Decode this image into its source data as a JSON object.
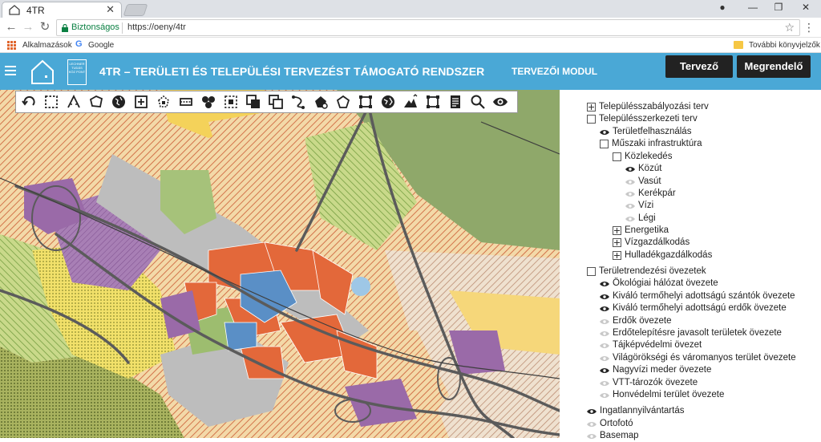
{
  "browser": {
    "tab_title": "4TR",
    "secure_label": "Biztonságos",
    "url": "https://oeny/4tr",
    "bookmarks": {
      "apps": "Alkalmazások",
      "google": "Google",
      "more": "További könyvjelzők"
    }
  },
  "header": {
    "logo_text": "LECHNER TUDÁS KÖZ PONT",
    "title": "4TR – TERÜLETI ÉS TELEPÜLÉSI TERVEZÉST TÁMOGATÓ RENDSZER",
    "module": "TERVEZŐI MODUL",
    "btn_planner": "Tervező",
    "btn_client": "Megrendelő"
  },
  "toolbar": {
    "tools": [
      "undo-icon",
      "select-rectangle-icon",
      "measure-distance-icon",
      "measure-area-icon",
      "globe-icon",
      "zoom-box-icon",
      "polygon-select-icon",
      "section-icon",
      "cluster-icon",
      "zoom-extent-icon",
      "layer-front-icon",
      "layer-copy-icon",
      "transform-icon",
      "shape-edit-icon",
      "pentagon-icon",
      "bounding-box-icon",
      "globe-2-icon",
      "terrain-icon",
      "frame-icon",
      "document-icon",
      "search-icon",
      "eye-icon"
    ]
  },
  "layers": [
    {
      "label": "Településszabályozási terv",
      "icon": "expand",
      "indent": 0
    },
    {
      "label": "Településszerkezeti terv",
      "icon": "checkbox",
      "indent": 0
    },
    {
      "label": "Területfelhasználás",
      "icon": "eye-on",
      "indent": 1
    },
    {
      "label": "Műszaki infrastruktúra",
      "icon": "checkbox",
      "indent": 1
    },
    {
      "label": "Közlekedés",
      "icon": "checkbox",
      "indent": 2
    },
    {
      "label": "Közút",
      "icon": "eye-on",
      "indent": 3
    },
    {
      "label": "Vasút",
      "icon": "eye-off",
      "indent": 3
    },
    {
      "label": "Kerékpár",
      "icon": "eye-off",
      "indent": 3
    },
    {
      "label": "Vízi",
      "icon": "eye-off",
      "indent": 3
    },
    {
      "label": "Légi",
      "icon": "eye-off",
      "indent": 3
    },
    {
      "label": "Energetika",
      "icon": "expand",
      "indent": 2
    },
    {
      "label": "Vízgazdálkodás",
      "icon": "expand",
      "indent": 2
    },
    {
      "label": "Hulladékgazdálkodás",
      "icon": "expand",
      "indent": 2
    },
    {
      "label": "Területrendezési övezetek",
      "icon": "checkbox",
      "indent": 0
    },
    {
      "label": "Ökológiai hálózat övezete",
      "icon": "eye-on",
      "indent": 1
    },
    {
      "label": "Kiváló termőhelyi adottságú szántók övezete",
      "icon": "eye-on",
      "indent": 1
    },
    {
      "label": "Kiváló termőhelyi adottságú erdők övezete",
      "icon": "eye-on",
      "indent": 1
    },
    {
      "label": "Erdők övezete",
      "icon": "eye-off",
      "indent": 1
    },
    {
      "label": "Erdőtelepítésre javasolt területek övezete",
      "icon": "eye-off",
      "indent": 1
    },
    {
      "label": "Tájképvédelmi övezet",
      "icon": "eye-off",
      "indent": 1
    },
    {
      "label": "Világörökségi és váromanyos terület övezete",
      "icon": "eye-off",
      "indent": 1
    },
    {
      "label": "Nagyvízi meder övezete",
      "icon": "eye-on",
      "indent": 1
    },
    {
      "label": "VTT-tározók övezete",
      "icon": "eye-off",
      "indent": 1
    },
    {
      "label": "Honvédelmi terület övezete",
      "icon": "eye-off",
      "indent": 1
    },
    {
      "label": "Ingatlannyilvántartás",
      "icon": "eye-on",
      "indent": 0
    },
    {
      "label": "Ortofotó",
      "icon": "eye-off",
      "indent": 0
    },
    {
      "label": "Basemap",
      "icon": "eye-off",
      "indent": 0
    }
  ],
  "colors": {
    "header_bg": "#4aa8d6",
    "map_yellow": "#f4d25a",
    "map_orange": "#e3683a",
    "map_purple": "#9a6aa8",
    "map_green": "#8db06f",
    "map_gray": "#b9b9b9",
    "map_blue": "#5a8fc6"
  }
}
